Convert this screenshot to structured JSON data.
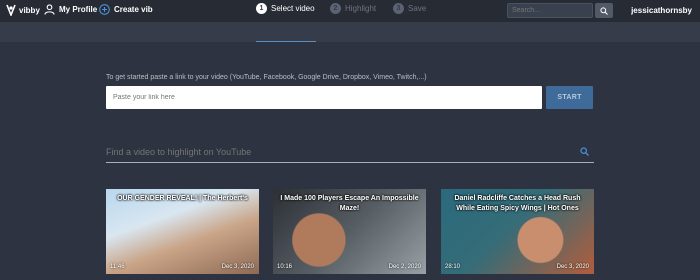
{
  "nav": {
    "brand": "vibby",
    "profile": "My Profile",
    "create": "Create vib",
    "search_placeholder": "Search...",
    "username": "jessicathornsby"
  },
  "steps": [
    {
      "num": "1",
      "label": "Select video"
    },
    {
      "num": "2",
      "label": "Highlight"
    },
    {
      "num": "3",
      "label": "Save"
    }
  ],
  "link": {
    "hint": "To get started paste a link to your video (YouTube, Facebook, Google Drive, Dropbox, Vimeo, Twitch,...)",
    "placeholder": "Paste your link here",
    "start": "START"
  },
  "youtube": {
    "placeholder": "Find a video to highlight on YouTube"
  },
  "videos": [
    {
      "title": "OUR GENDER REVEAL! | The Herbert's",
      "duration": "11:46",
      "date": "Dec 3, 2020"
    },
    {
      "title": "I Made 100 Players Escape An Impossible Maze!",
      "duration": "10:16",
      "date": "Dec 2, 2020"
    },
    {
      "title": "Daniel Radcliffe Catches a Head Rush While Eating Spicy Wings | Hot Ones",
      "duration": "28:10",
      "date": "Dec 3, 2020"
    }
  ],
  "colors": {
    "background": "#2d3340",
    "topbar": "#272b34",
    "stepsbar": "#363c49",
    "start_button": "#3e6b9a",
    "accent": "#4a90d9"
  }
}
